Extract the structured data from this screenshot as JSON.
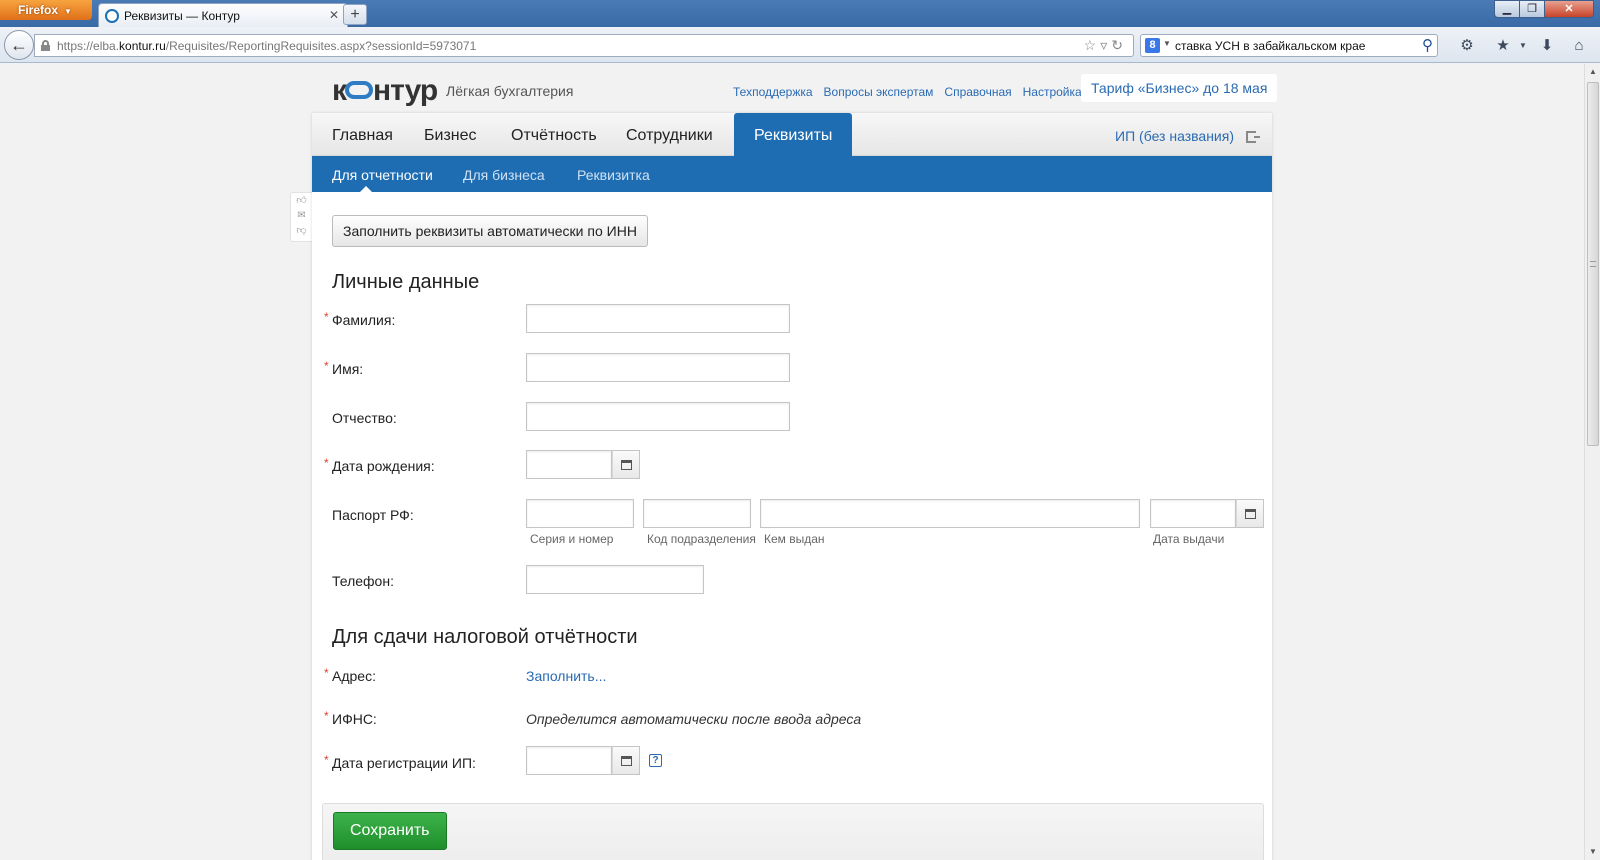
{
  "browser": {
    "app_button": "Firefox",
    "tab_title": "Реквизиты — Контур",
    "new_tab": "+",
    "url_prefix": "https://elba.",
    "url_domain": "kontur.ru",
    "url_path": "/Requisites/ReportingRequisites.aspx?sessionId=5973071",
    "search_query": "ставка УСН в забайкальском крае",
    "search_engine_icon": "8"
  },
  "header": {
    "logo_part1": "к",
    "logo_part2": "нтур",
    "logo_subtitle": "Лёгкая бухгалтерия",
    "links": [
      "Техподдержка",
      "Вопросы экспертам",
      "Справочная",
      "Настройка"
    ],
    "tariff": "Тариф «Бизнес» до 18 мая"
  },
  "main_nav": {
    "items": [
      "Главная",
      "Бизнес",
      "Отчётность",
      "Сотрудники",
      "Реквизиты"
    ],
    "active_index": 4,
    "user": "ИП (без названия)"
  },
  "sub_nav": {
    "items": [
      "Для отчетности",
      "Для бизнеса",
      "Реквизитка"
    ],
    "active_index": 0
  },
  "form": {
    "fill_by_inn_button": "Заполнить реквизиты автоматически по ИНН",
    "personal_title": "Личные данные",
    "labels": {
      "surname": "Фамилия:",
      "name": "Имя:",
      "patronymic": "Отчество:",
      "birth_date": "Дата рождения:",
      "passport": "Паспорт РФ:",
      "phone": "Телефон:"
    },
    "passport_hints": {
      "series": "Серия и номер",
      "division": "Код подразделения",
      "issued_by": "Кем выдан",
      "issue_date": "Дата выдачи"
    },
    "tax_title": "Для сдачи налоговой отчётности",
    "tax_labels": {
      "address": "Адрес:",
      "ifns": "ИФНС:",
      "registration_date": "Дата регистрации ИП:"
    },
    "address_link": "Заполнить...",
    "ifns_text": "Определится автоматически после ввода адреса",
    "required_mark": "*",
    "help": "?",
    "save_button": "Сохранить"
  },
  "icons": {
    "back": "back-arrow-icon",
    "lock": "lock-icon",
    "search": "magnifier-icon",
    "calendar": "calendar-icon",
    "exit": "exit-icon"
  },
  "colors": {
    "brand_blue": "#1e6db3",
    "link": "#2a6bb3",
    "save_green": "#2ea23c",
    "required": "#dd4433"
  }
}
